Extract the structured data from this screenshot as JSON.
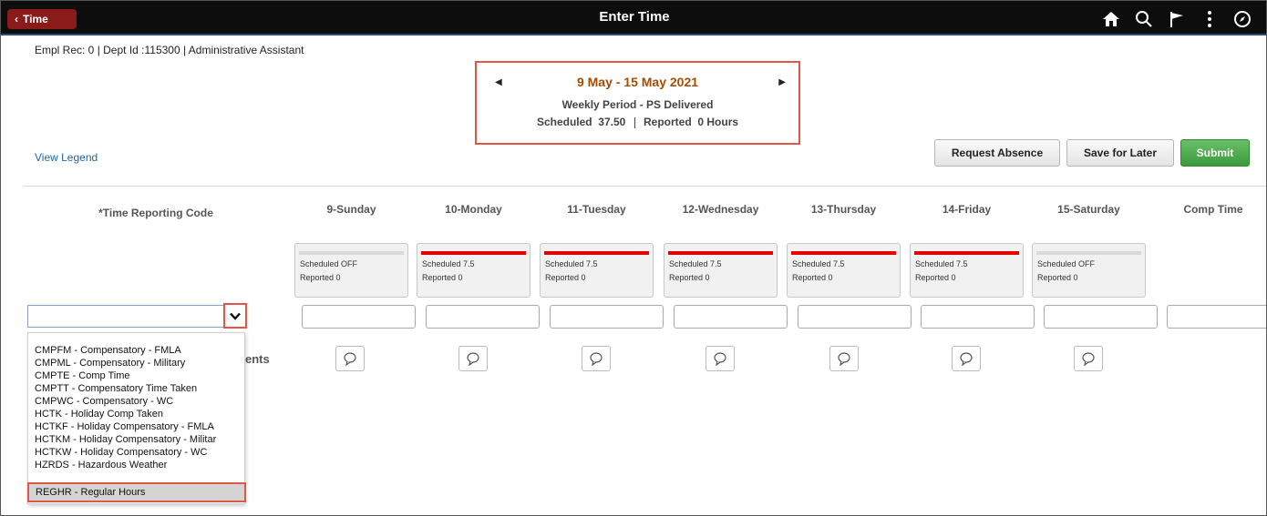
{
  "header": {
    "back_label": "Time",
    "title": "Enter Time"
  },
  "employee": {
    "info": "Empl Rec: 0 | Dept Id :115300 | Administrative Assistant"
  },
  "period": {
    "dates": "9 May - 15 May 2021",
    "type": "Weekly Period - PS Delivered",
    "scheduled_label": "Scheduled",
    "scheduled_value": "37.50",
    "reported_label": "Reported",
    "reported_value": "0 Hours"
  },
  "actions": {
    "view_legend": "View Legend",
    "request_absence": "Request Absence",
    "save_for_later": "Save for Later",
    "submit": "Submit"
  },
  "grid": {
    "trc_header": "*Time Reporting Code",
    "comp_time_header": "Comp Time",
    "comments_partial": "ents",
    "days": [
      {
        "label": "9-Sunday",
        "scheduled": "Scheduled OFF",
        "reported": "Reported  0",
        "scheduled_on": false
      },
      {
        "label": "10-Monday",
        "scheduled": "Scheduled 7.5",
        "reported": "Reported  0",
        "scheduled_on": true
      },
      {
        "label": "11-Tuesday",
        "scheduled": "Scheduled 7.5",
        "reported": "Reported  0",
        "scheduled_on": true
      },
      {
        "label": "12-Wednesday",
        "scheduled": "Scheduled 7.5",
        "reported": "Reported  0",
        "scheduled_on": true
      },
      {
        "label": "13-Thursday",
        "scheduled": "Scheduled 7.5",
        "reported": "Reported  0",
        "scheduled_on": true
      },
      {
        "label": "14-Friday",
        "scheduled": "Scheduled 7.5",
        "reported": "Reported  0",
        "scheduled_on": true
      },
      {
        "label": "15-Saturday",
        "scheduled": "Scheduled OFF",
        "reported": "Reported  0",
        "scheduled_on": false
      }
    ]
  },
  "trc_dropdown": {
    "options": [
      "CMPFM - Compensatory - FMLA",
      "CMPML - Compensatory - Military",
      "CMPTE - Comp Time",
      "CMPTT - Compensatory Time Taken",
      "CMPWC - Compensatory - WC",
      "HCTK - Holiday Comp Taken",
      "HCTKF - Holiday Compensatory - FMLA",
      "HCTKM - Holiday Compensatory - Militar",
      "HCTKW - Holiday Compensatory - WC",
      "HZRDS - Hazardous Weather"
    ],
    "selected": "REGHR - Regular Hours"
  },
  "colors": {
    "accent_red": "#e0574a",
    "schedule_bar": "#e60000",
    "submit_green": "#3a9a3a",
    "period_orange": "#a84b00"
  }
}
